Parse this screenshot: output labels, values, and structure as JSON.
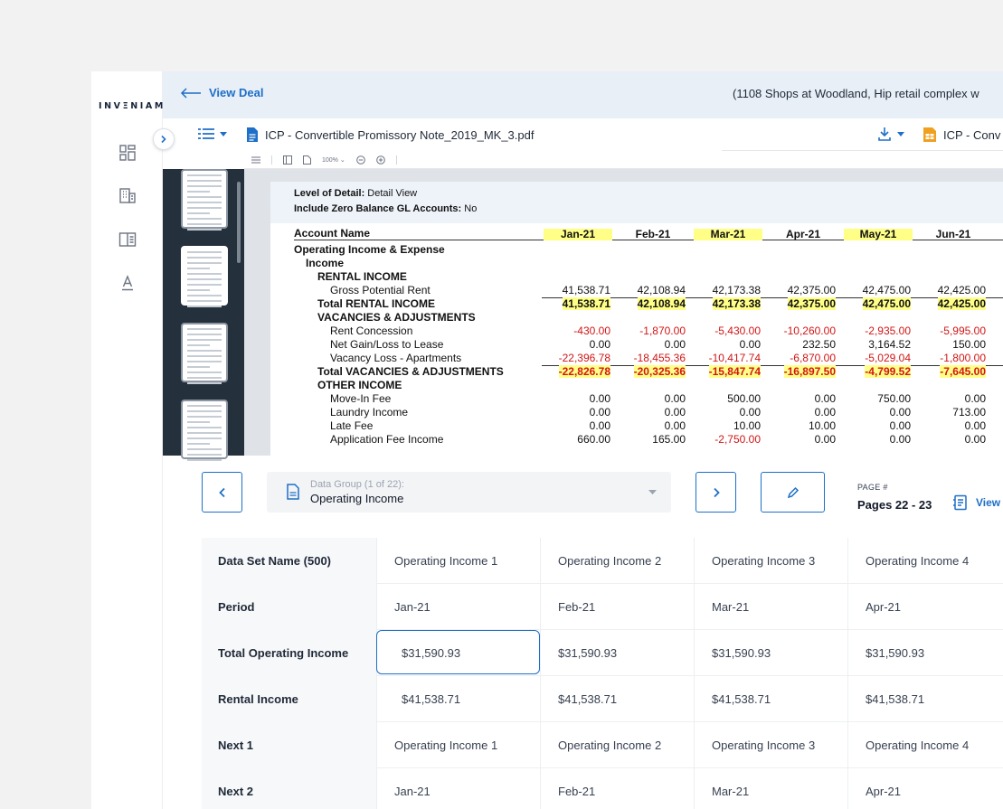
{
  "brand": "INVΞNIAM",
  "topbar": {
    "back_label": "View Deal",
    "deal_title": "(1108 Shops at Woodland, Hip retail complex w"
  },
  "docbar": {
    "doc_name": "ICP - Convertible Promissory Note_2019_MK_3.pdf",
    "doc2_name": "ICP - Conv"
  },
  "viewer": {
    "zoom": "100%",
    "thumb_count": 4,
    "meta": [
      {
        "label": "Level of Detail:",
        "value": " Detail View"
      },
      {
        "label": "Include Zero Balance GL Accounts:",
        "value": " No"
      }
    ],
    "account_header": "Account Name",
    "months": [
      "Jan-21",
      "Feb-21",
      "Mar-21",
      "Apr-21",
      "May-21",
      "Jun-21"
    ],
    "rows": [
      {
        "label": "Operating Income & Expense",
        "indent": 0,
        "bold": true,
        "values": []
      },
      {
        "label": "Income",
        "indent": 1,
        "bold": true,
        "values": []
      },
      {
        "label": "RENTAL INCOME",
        "indent": 2,
        "bold": true,
        "values": []
      },
      {
        "label": "Gross Potential Rent",
        "indent": 3,
        "bold": false,
        "values": [
          "41,538.71",
          "42,108.94",
          "42,173.38",
          "42,375.00",
          "42,475.00",
          "42,425.00"
        ]
      },
      {
        "label": "Total RENTAL INCOME",
        "indent": 2,
        "bold": true,
        "total": true,
        "values": [
          "41,538.71",
          "42,108.94",
          "42,173.38",
          "42,375.00",
          "42,475.00",
          "42,425.00"
        ]
      },
      {
        "label": "VACANCIES & ADJUSTMENTS",
        "indent": 2,
        "bold": true,
        "values": []
      },
      {
        "label": "Rent Concession",
        "indent": 3,
        "bold": false,
        "values": [
          "-430.00",
          "-1,870.00",
          "-5,430.00",
          "-10,260.00",
          "-2,935.00",
          "-5,995.00"
        ]
      },
      {
        "label": "Net Gain/Loss to Lease",
        "indent": 3,
        "bold": false,
        "values": [
          "0.00",
          "0.00",
          "0.00",
          "232.50",
          "3,164.52",
          "150.00"
        ]
      },
      {
        "label": "Vacancy Loss - Apartments",
        "indent": 3,
        "bold": false,
        "values": [
          "-22,396.78",
          "-18,455.36",
          "-10,417.74",
          "-6,870.00",
          "-5,029.04",
          "-1,800.00"
        ]
      },
      {
        "label": "Total VACANCIES & ADJUSTMENTS",
        "indent": 2,
        "bold": true,
        "total": true,
        "values": [
          "-22,826.78",
          "-20,325.36",
          "-15,847.74",
          "-16,897.50",
          "-4,799.52",
          "-7,645.00"
        ]
      },
      {
        "label": "OTHER INCOME",
        "indent": 2,
        "bold": true,
        "values": []
      },
      {
        "label": "Move-In Fee",
        "indent": 3,
        "bold": false,
        "values": [
          "0.00",
          "0.00",
          "500.00",
          "0.00",
          "750.00",
          "0.00"
        ]
      },
      {
        "label": "Laundry Income",
        "indent": 3,
        "bold": false,
        "values": [
          "0.00",
          "0.00",
          "0.00",
          "0.00",
          "0.00",
          "713.00"
        ]
      },
      {
        "label": "Late Fee",
        "indent": 3,
        "bold": false,
        "values": [
          "0.00",
          "0.00",
          "10.00",
          "10.00",
          "0.00",
          "0.00"
        ]
      },
      {
        "label": "Application Fee Income",
        "indent": 3,
        "bold": false,
        "values": [
          "660.00",
          "165.00",
          "-2,750.00",
          "0.00",
          "0.00",
          "0.00"
        ]
      }
    ]
  },
  "controls": {
    "data_group_label": "Data Group (1 of 22):",
    "data_group_value": "Operating Income",
    "page_label": "PAGE #",
    "page_value": "Pages 22 - 23",
    "view_label": "View"
  },
  "table": {
    "rows": [
      {
        "label": "Data Set Name (500)",
        "cells": [
          "Operating Income 1",
          "Operating Income 2",
          "Operating Income 3",
          "Operating Income 4"
        ]
      },
      {
        "label": "Period",
        "cells": [
          "Jan-21",
          "Feb-21",
          "Mar-21",
          "Apr-21"
        ]
      },
      {
        "label": "Total Operating Income",
        "cells": [
          "$31,590.93",
          "$31,590.93",
          "$31,590.93",
          "$31,590.93"
        ]
      },
      {
        "label": "Rental Income",
        "cells": [
          "$41,538.71",
          "$41,538.71",
          "$41,538.71",
          "$41,538.71"
        ]
      },
      {
        "label": "Next 1",
        "cells": [
          "Operating Income 1",
          "Operating Income 2",
          "Operating Income 3",
          "Operating Income 4"
        ]
      },
      {
        "label": "Next 2",
        "cells": [
          "Jan-21",
          "Feb-21",
          "Mar-21",
          "Apr-21"
        ]
      }
    ]
  }
}
